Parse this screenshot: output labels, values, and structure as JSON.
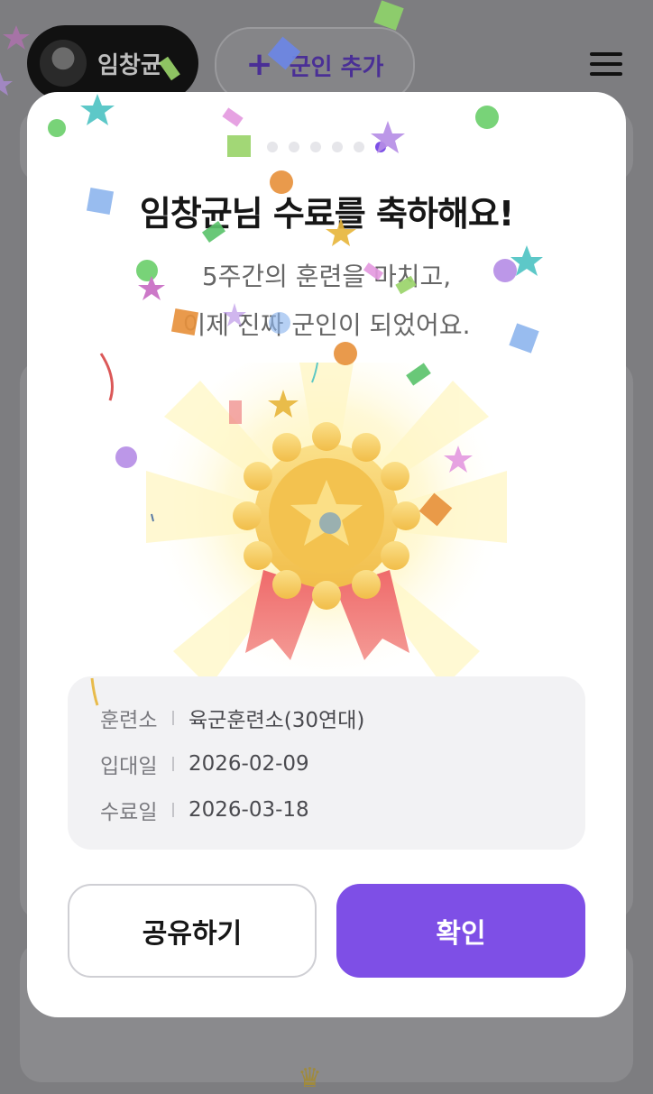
{
  "header": {
    "profile_name": "임창균",
    "add_label": "군인 추가",
    "add_icon": "plus-icon",
    "menu_icon": "hamburger-menu-icon"
  },
  "modal": {
    "page_indicator": {
      "total": 6,
      "active": 6
    },
    "title": "임창균님 수료를 축하해요!",
    "subtitle_line1": "5주간의 훈련을 마치고,",
    "subtitle_line2": "이제 진짜 군인이 되었어요.",
    "medal_icon": "medal-icon",
    "info": [
      {
        "key": "훈련소",
        "value": "육군훈련소(30연대)"
      },
      {
        "key": "입대일",
        "value": "2026-02-09"
      },
      {
        "key": "수료일",
        "value": "2026-03-18"
      }
    ],
    "share_button": "공유하기",
    "confirm_button": "확인"
  },
  "colors": {
    "accent": "#7E4FE6",
    "overlay": "#7D7D80",
    "info_bg": "#F2F2F4",
    "medal_gold": "#F5C94F",
    "ribbon": "#EE6B6B"
  }
}
